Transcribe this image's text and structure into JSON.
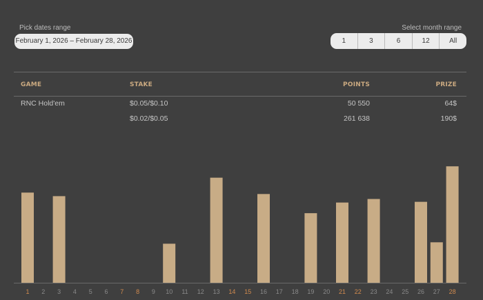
{
  "filters": {
    "date_label": "Pick dates range",
    "date_range": "February 1, 2026 – February 28, 2026",
    "month_label": "Select month range",
    "month_options": [
      "1",
      "3",
      "6",
      "12",
      "All"
    ]
  },
  "table": {
    "headers": {
      "game": "GAME",
      "stake": "STAKE",
      "points": "POINTS",
      "prize": "PRIZE"
    },
    "rows": [
      {
        "game": "RNC Hold'em",
        "stake": "$0.05/$0.10",
        "points": "50 550",
        "prize": "64$"
      },
      {
        "game": "",
        "stake": "$0.02/$0.05",
        "points": "261 638",
        "prize": "190$"
      }
    ]
  },
  "colors": {
    "background": "#3f3f3f",
    "bar": "#c8ac86",
    "accent_header": "#caa980",
    "weekend_label": "#d08a4e",
    "weekday_label": "#8a8a8a"
  },
  "chart_data": {
    "type": "bar",
    "categories": [
      "1",
      "2",
      "3",
      "4",
      "5",
      "6",
      "7",
      "8",
      "9",
      "10",
      "11",
      "12",
      "13",
      "14",
      "15",
      "16",
      "17",
      "18",
      "19",
      "20",
      "21",
      "22",
      "23",
      "24",
      "25",
      "26",
      "27",
      "28"
    ],
    "values": [
      127,
      0,
      122,
      0,
      0,
      0,
      0,
      0,
      0,
      55,
      0,
      0,
      148,
      0,
      0,
      125,
      0,
      0,
      98,
      0,
      113,
      0,
      118,
      0,
      0,
      114,
      57,
      164
    ],
    "highlighted_categories": [
      "1",
      "7",
      "8",
      "14",
      "15",
      "21",
      "22",
      "28"
    ],
    "ylim": [
      0,
      170
    ],
    "grid": false,
    "title": "",
    "xlabel": "",
    "ylabel": ""
  }
}
